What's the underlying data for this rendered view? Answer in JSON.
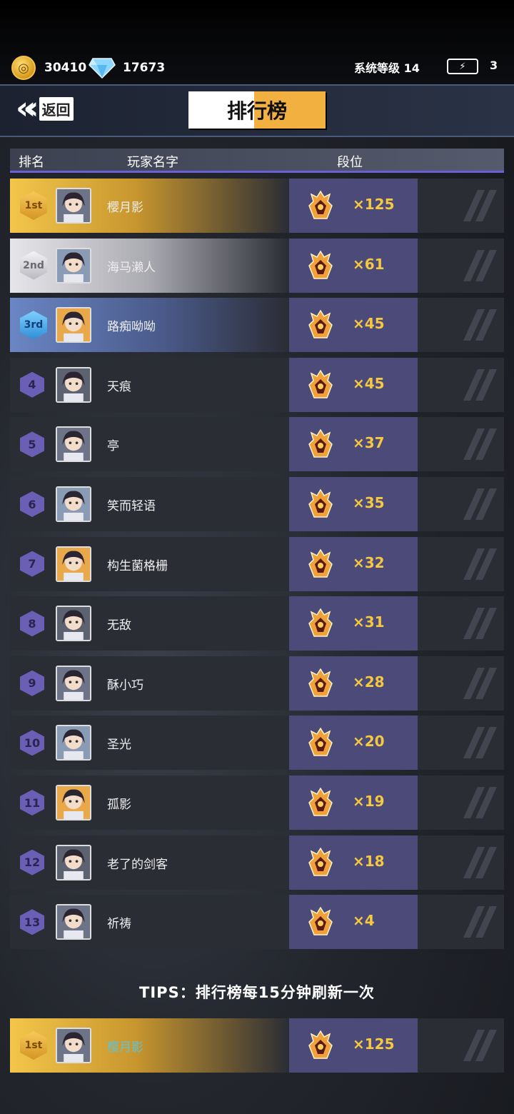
{
  "status": {
    "coins": "30410",
    "gems": "17673",
    "system_level": "系统等级 14",
    "energy": "3"
  },
  "header": {
    "back_label": "返回",
    "title": "排行榜"
  },
  "columns": {
    "rank": "排名",
    "player": "玩家名字",
    "tier": "段位"
  },
  "rows": [
    {
      "rank": "1st",
      "name": "樱月影",
      "score": "×125",
      "style": "gold"
    },
    {
      "rank": "2nd",
      "name": "海马濑人",
      "score": "×61",
      "style": "silver"
    },
    {
      "rank": "3rd",
      "name": "路痴呦呦",
      "score": "×45",
      "style": "blue"
    },
    {
      "rank": "4",
      "name": "天痕",
      "score": "×45",
      "style": "normal"
    },
    {
      "rank": "5",
      "name": "亭",
      "score": "×37",
      "style": "normal"
    },
    {
      "rank": "6",
      "name": "笑而轻语",
      "score": "×35",
      "style": "normal"
    },
    {
      "rank": "7",
      "name": "构生菌格栅",
      "score": "×32",
      "style": "normal"
    },
    {
      "rank": "8",
      "name": "无敌",
      "score": "×31",
      "style": "normal"
    },
    {
      "rank": "9",
      "name": "酥小巧",
      "score": "×28",
      "style": "normal"
    },
    {
      "rank": "10",
      "name": "圣光",
      "score": "×20",
      "style": "normal"
    },
    {
      "rank": "11",
      "name": "孤影",
      "score": "×19",
      "style": "normal"
    },
    {
      "rank": "12",
      "name": "老了的剑客",
      "score": "×18",
      "style": "normal"
    },
    {
      "rank": "13",
      "name": "祈祷",
      "score": "×4",
      "style": "normal"
    }
  ],
  "tips": "TIPS：排行榜每15分钟刷新一次",
  "my_rank": {
    "rank": "1st",
    "name": "樱月影",
    "score": "×125"
  },
  "colors": {
    "accent": "#f2b041",
    "score": "#f5c842",
    "tier_bg": "#4b4a78",
    "my_name": "#5fc2d9"
  }
}
